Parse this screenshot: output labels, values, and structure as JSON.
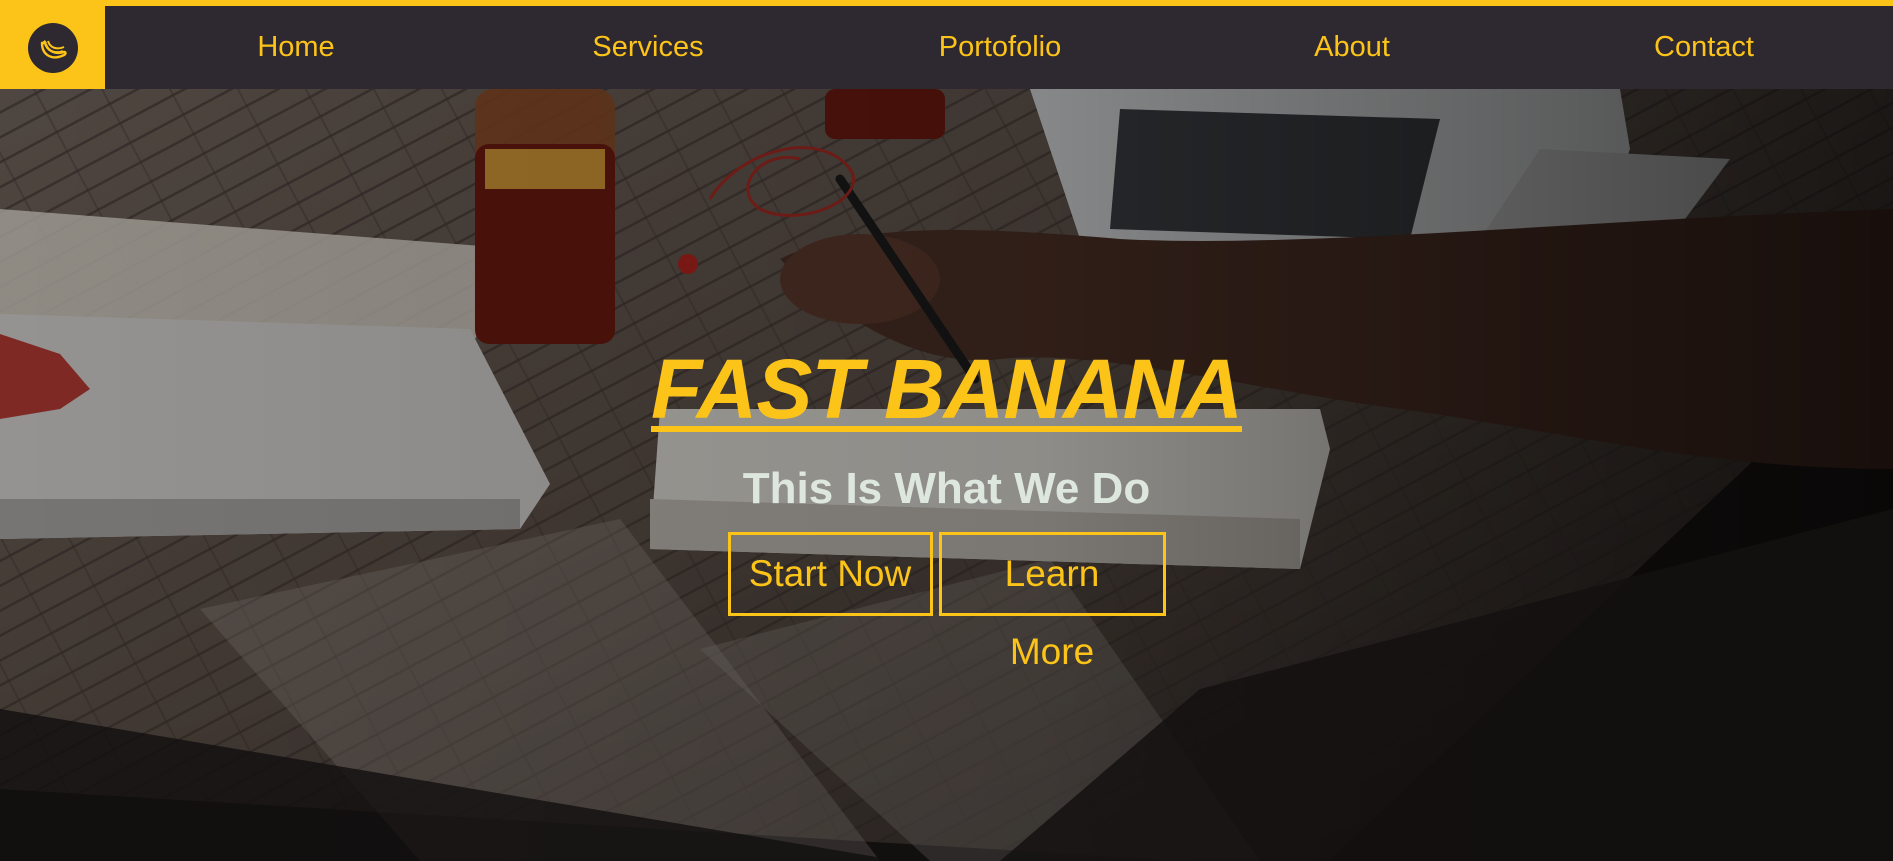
{
  "brand": {
    "logo_icon": "banana-icon",
    "accent_color": "#fcc419",
    "nav_background": "#2e2830"
  },
  "nav": {
    "items": [
      {
        "label": "Home"
      },
      {
        "label": "Services"
      },
      {
        "label": "Portofolio"
      },
      {
        "label": "About"
      },
      {
        "label": "Contact"
      }
    ]
  },
  "hero": {
    "title": "FAST BANANA",
    "subtitle": "This Is What We Do",
    "primary_button": "Start Now",
    "secondary_button": "Learn More",
    "background": "hero-background-image"
  }
}
